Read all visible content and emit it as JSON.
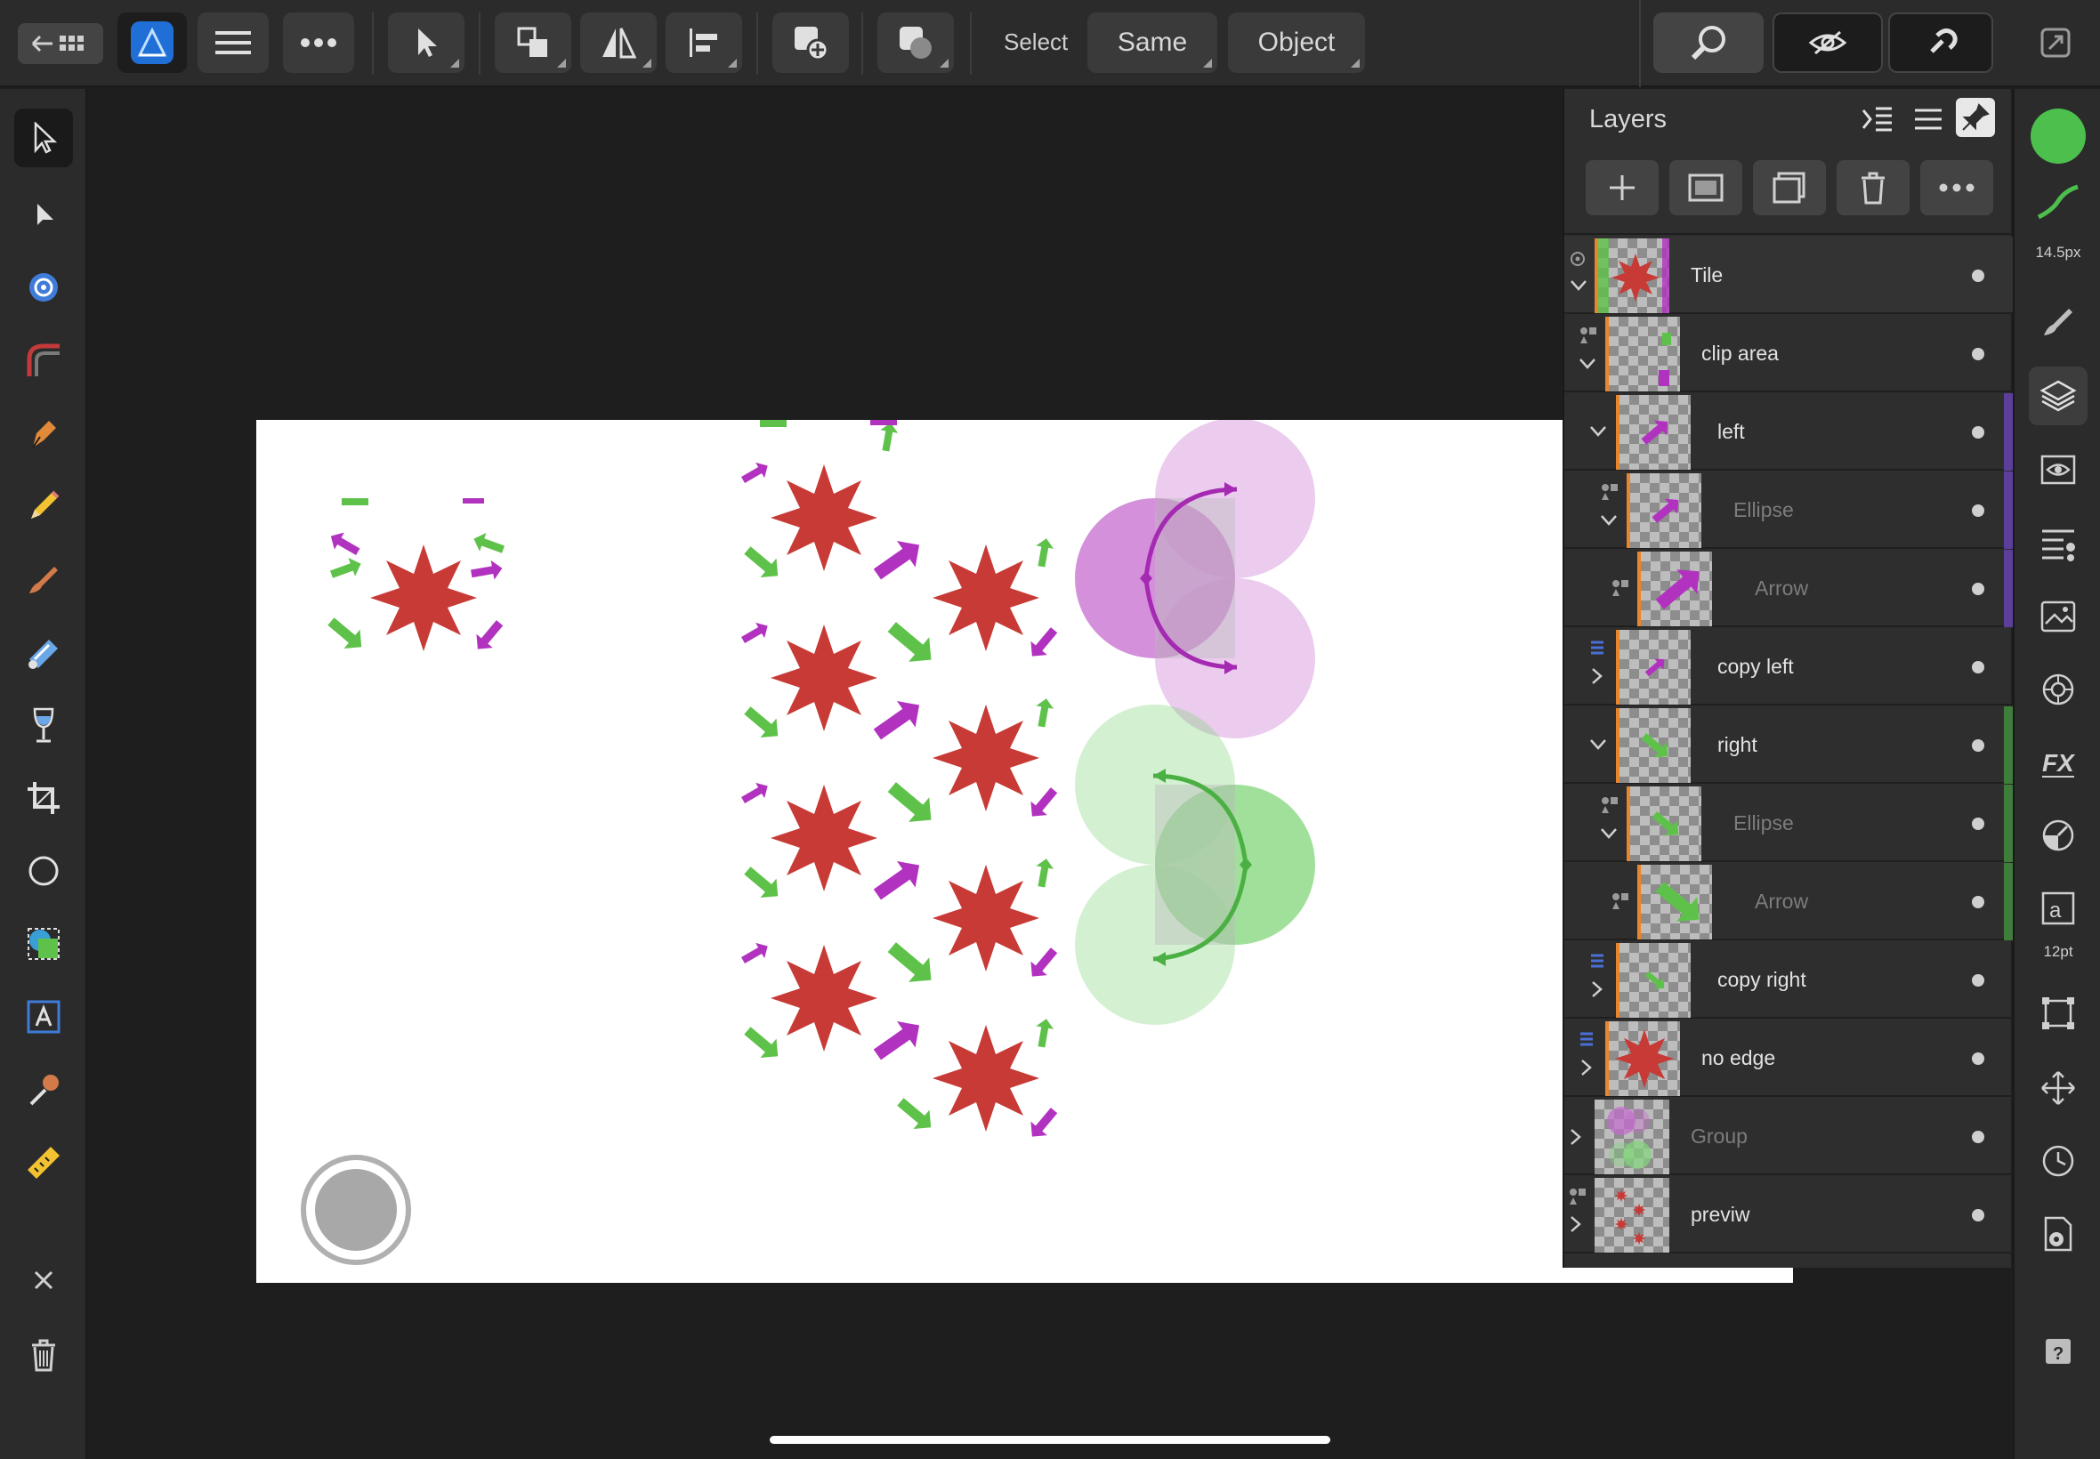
{
  "toolbar": {
    "select_label": "Select",
    "same_label": "Same",
    "object_label": "Object",
    "icons": [
      "back-arrow-icon",
      "grid-icon",
      "affinity-designer-logo",
      "hamburger-menu-icon",
      "more-dots-icon",
      "move-tool-icon",
      "arrange-icon",
      "flip-icon",
      "align-icon",
      "insert-icon",
      "boolean-icon",
      "zoom-icon",
      "view-mode-icon",
      "snapping-icon",
      "fullscreen-icon"
    ]
  },
  "right_strip": {
    "brush_size": "14.5px",
    "font_size": "12pt",
    "fill_color": "#4cbf4c"
  },
  "layers": {
    "title": "Layers",
    "items": [
      {
        "name": "Tile",
        "dim": false
      },
      {
        "name": "clip area",
        "dim": false
      },
      {
        "name": "left",
        "dim": false
      },
      {
        "name": "Ellipse",
        "dim": true
      },
      {
        "name": "Arrow",
        "dim": true
      },
      {
        "name": "copy left",
        "dim": false
      },
      {
        "name": "right",
        "dim": false
      },
      {
        "name": "Ellipse",
        "dim": true
      },
      {
        "name": "Arrow",
        "dim": true
      },
      {
        "name": "copy right",
        "dim": false
      },
      {
        "name": "no edge",
        "dim": false
      },
      {
        "name": "Group",
        "dim": true
      },
      {
        "name": "previw",
        "dim": false
      }
    ]
  },
  "colors": {
    "star_red": "#c73a36",
    "arrow_green": "#5ec24a",
    "arrow_purple": "#b232c0",
    "circle_purple": "#c56bcd",
    "circle_green": "#82d57a",
    "left_bar": "#5b3f9b",
    "right_bar": "#3f7d3a"
  }
}
